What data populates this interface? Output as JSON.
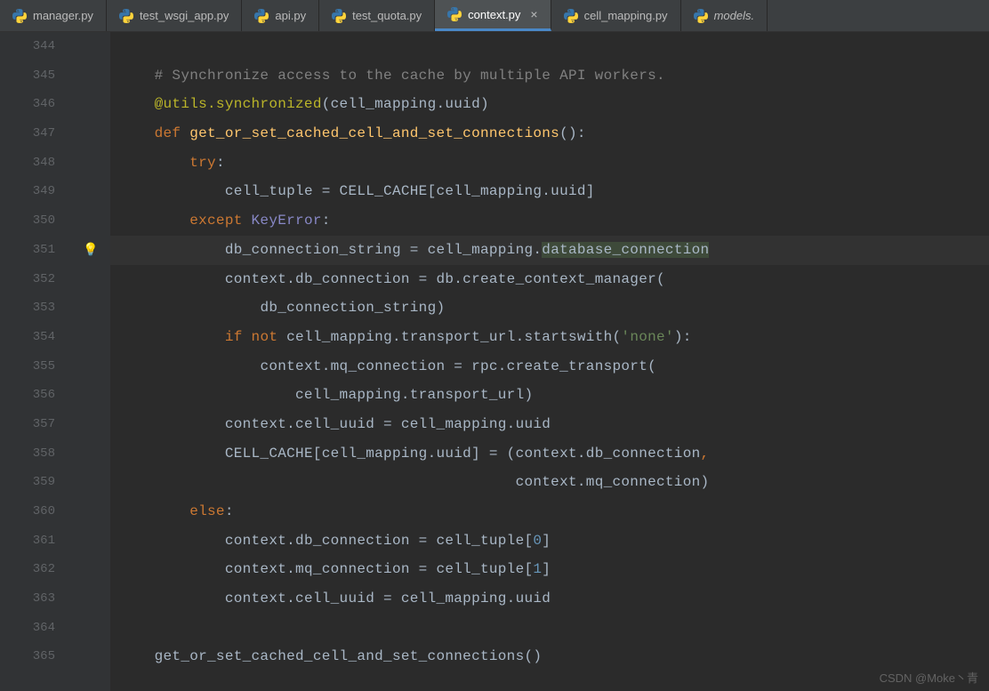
{
  "tabs": [
    {
      "label": "manager.py"
    },
    {
      "label": "test_wsgi_app.py"
    },
    {
      "label": "api.py"
    },
    {
      "label": "test_quota.py"
    },
    {
      "label": "context.py"
    },
    {
      "label": "cell_mapping.py"
    },
    {
      "label": "models."
    }
  ],
  "active_tab_index": 4,
  "watermark": "CSDN @Moke丶青",
  "line_numbers": [
    "344",
    "345",
    "346",
    "347",
    "348",
    "349",
    "350",
    "351",
    "352",
    "353",
    "354",
    "355",
    "356",
    "357",
    "358",
    "359",
    "360",
    "361",
    "362",
    "363",
    "364",
    "365"
  ],
  "bulb_line": "351",
  "code": {
    "l344": "",
    "l345_comment": "# Synchronize access to the cache by multiple API workers.",
    "l346_decorator": "@utils.synchronized",
    "l346_args": "(cell_mapping.uuid)",
    "l347_def": "def ",
    "l347_func": "get_or_set_cached_cell_and_set_connections",
    "l347_tail": "():",
    "l348_try": "try",
    "l348_colon": ":",
    "l349": "cell_tuple = CELL_CACHE[cell_mapping.uuid]",
    "l350_except": "except ",
    "l350_err": "KeyError",
    "l350_colon": ":",
    "l351_a": "db_connection_string = cell_mapping.",
    "l351_b": "database_connection",
    "l352": "context.db_connection = db.create_context_manager(",
    "l353": "db_connection_string)",
    "l354_if": "if ",
    "l354_not": "not ",
    "l354_a": "cell_mapping.transport_url.startswith(",
    "l354_str": "'none'",
    "l354_tail": "):",
    "l355": "context.mq_connection = rpc.create_transport(",
    "l356": "cell_mapping.transport_url)",
    "l357": "context.cell_uuid = cell_mapping.uuid",
    "l358_a": "CELL_CACHE[cell_mapping.uuid] = (context.db_connection",
    "l358_comma": ",",
    "l359": "context.mq_connection)",
    "l360_else": "else",
    "l360_colon": ":",
    "l361_a": "context.db_connection = cell_tuple[",
    "l361_n": "0",
    "l361_b": "]",
    "l362_a": "context.mq_connection = cell_tuple[",
    "l362_n": "1",
    "l362_b": "]",
    "l363": "context.cell_uuid = cell_mapping.uuid",
    "l364": "",
    "l365": "get_or_set_cached_cell_and_set_connections()"
  }
}
